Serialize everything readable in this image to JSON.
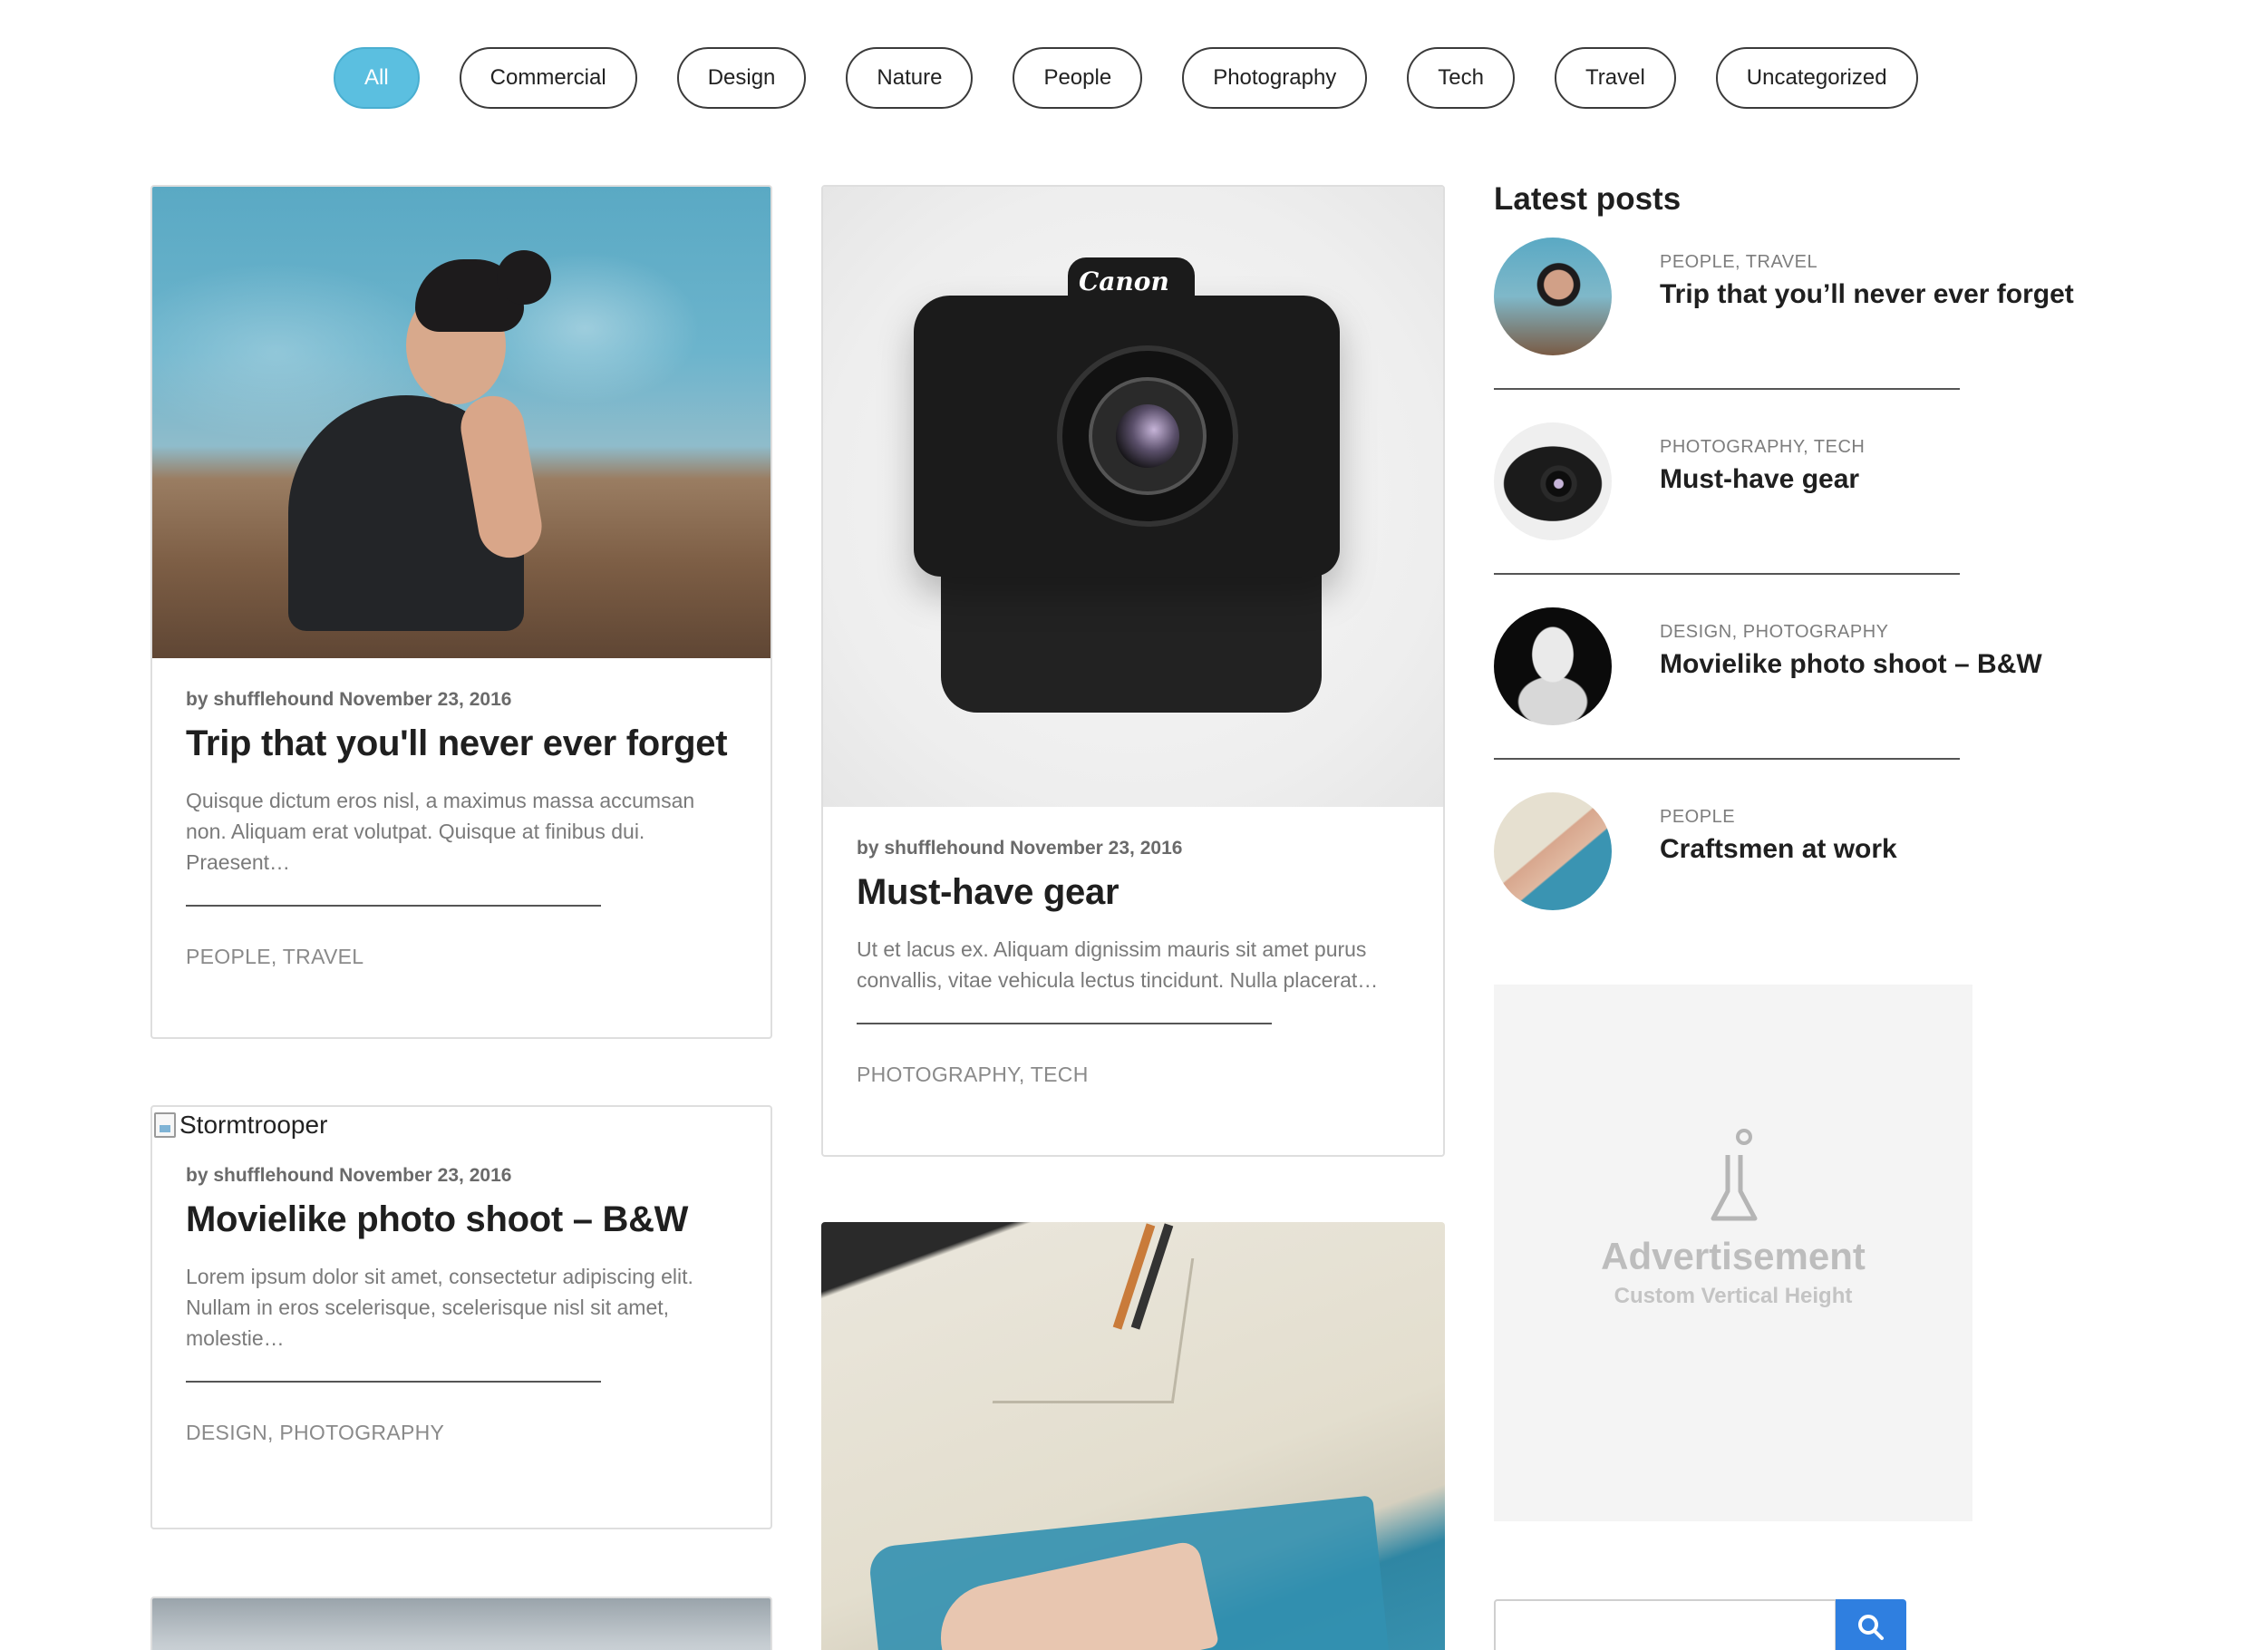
{
  "filters": [
    {
      "label": "All",
      "active": true
    },
    {
      "label": "Commercial",
      "active": false
    },
    {
      "label": "Design",
      "active": false
    },
    {
      "label": "Nature",
      "active": false
    },
    {
      "label": "People",
      "active": false
    },
    {
      "label": "Photography",
      "active": false
    },
    {
      "label": "Tech",
      "active": false
    },
    {
      "label": "Travel",
      "active": false
    },
    {
      "label": "Uncategorized",
      "active": false
    }
  ],
  "posts": [
    {
      "meta": "by shufflehound November 23, 2016",
      "title": "Trip that you'll never ever forget",
      "excerpt": "Quisque dictum eros nisl, a maximus massa accumsan non. Aliquam erat volutpat. Quisque at finibus dui. Praesent…",
      "categories": "PEOPLE, TRAVEL",
      "image": "woman-by-sea-photo"
    },
    {
      "meta": "by shufflehound November 23, 2016",
      "title": "Must-have gear",
      "excerpt": "Ut et lacus ex. Aliquam dignissim mauris sit amet purus convallis, vitae vehicula lectus tincidunt. Nulla placerat…",
      "categories": "PHOTOGRAPHY, TECH",
      "image": "canon-camera-photo",
      "camera_brand": "Canon"
    },
    {
      "meta": "by shufflehound November 23, 2016",
      "title": "Movielike photo shoot – B&W",
      "excerpt": "Lorem ipsum dolor sit amet, consectetur adipiscing elit. Nullam in eros scelerisque, scelerisque nisl sit amet, molestie…",
      "categories": "DESIGN, PHOTOGRAPHY",
      "image_alt": "Stormtrooper"
    }
  ],
  "sidebar": {
    "heading": "Latest posts",
    "items": [
      {
        "categories": "PEOPLE, TRAVEL",
        "title": "Trip that you’ll never ever forget",
        "thumb": "sea-thumb"
      },
      {
        "categories": "PHOTOGRAPHY, TECH",
        "title": "Must-have gear",
        "thumb": "camera-thumb"
      },
      {
        "categories": "DESIGN, PHOTOGRAPHY",
        "title": "Movielike photo shoot – B&W",
        "thumb": "stormtrooper-thumb"
      },
      {
        "categories": "PEOPLE",
        "title": "Craftsmen at work",
        "thumb": "craftsman-thumb"
      }
    ],
    "ad": {
      "title": "Advertisement",
      "subtitle": "Custom Vertical Height",
      "icon": "flask-icon"
    },
    "search": {
      "placeholder": "",
      "button_icon": "search-icon"
    }
  },
  "colors": {
    "accent_active_pill": "#5bbfe0",
    "search_button": "#2f7fe0"
  }
}
